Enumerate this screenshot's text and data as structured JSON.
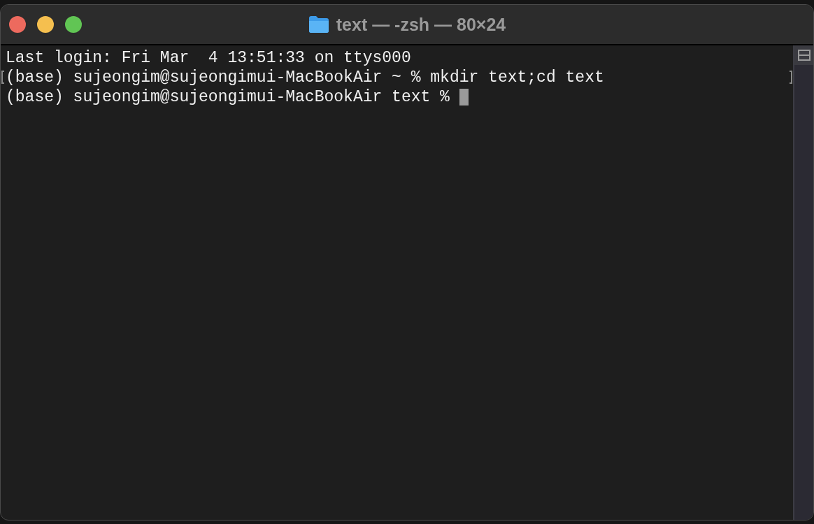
{
  "window": {
    "title": "text — -zsh — 80×24"
  },
  "terminal": {
    "lines": [
      {
        "text": "Last login: Fri Mar  4 13:51:33 on ttys000",
        "marked": false,
        "cursor": false
      },
      {
        "text": "(base) sujeongim@sujeongimui-MacBookAir ~ % mkdir text;cd text",
        "marked": true,
        "cursor": false
      },
      {
        "text": "(base) sujeongim@sujeongimui-MacBookAir text % ",
        "marked": false,
        "cursor": true
      }
    ]
  }
}
